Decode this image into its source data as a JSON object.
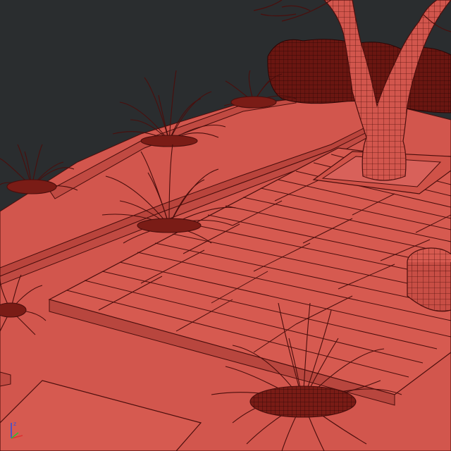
{
  "viewport": {
    "background_color": "#2a2d2f",
    "material_color": "#d2564d",
    "wire_color": "#4a0e0c"
  },
  "axis_gizmo": {
    "x_color": "#e03030",
    "y_color": "#30c030",
    "z_color": "#3050e0",
    "z_label": "z"
  },
  "scene_objects": [
    {
      "name": "tree-trunk",
      "type": "wireframe-mesh"
    },
    {
      "name": "hedge",
      "type": "wireframe-mesh"
    },
    {
      "name": "decking",
      "type": "wireframe-mesh"
    },
    {
      "name": "pouf",
      "type": "wireframe-mesh"
    },
    {
      "name": "grass-plant",
      "type": "wireframe-mesh",
      "count": 6
    }
  ]
}
